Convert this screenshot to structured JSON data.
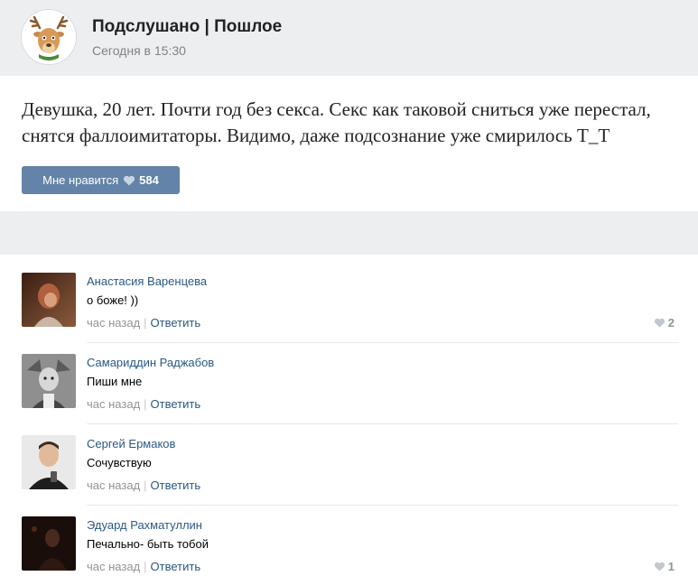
{
  "post": {
    "group_name": "Подслушано | Пошлое",
    "time": "Сегодня в 15:30",
    "text": "Девушка, 20 лет. Почти год без секса. Секс как таковой сниться уже перестал, снятся фаллоимитаторы. Видимо, даже подсознание уже смирилось Т_Т",
    "like_label": "Мне нравится",
    "like_count": "584",
    "group_avatar_icon": "reindeer-icon"
  },
  "comments": [
    {
      "author": "Анастасия Варенцева",
      "text": "о боже! ))",
      "time": "час назад",
      "reply": "Ответить",
      "likes": "2"
    },
    {
      "author": "Самариддин Раджабов",
      "text": "Пиши мне",
      "time": "час назад",
      "reply": "Ответить",
      "likes": ""
    },
    {
      "author": "Сергей Ермаков",
      "text": "Сочувствую",
      "time": "час назад",
      "reply": "Ответить",
      "likes": ""
    },
    {
      "author": "Эдуард Рахматуллин",
      "text": "Печально- быть тобой",
      "time": "час назад",
      "reply": "Ответить",
      "likes": "1"
    }
  ],
  "colors": {
    "accent": "#6383a8",
    "link": "#2a5885",
    "muted": "#939393",
    "band": "#edeef0"
  }
}
